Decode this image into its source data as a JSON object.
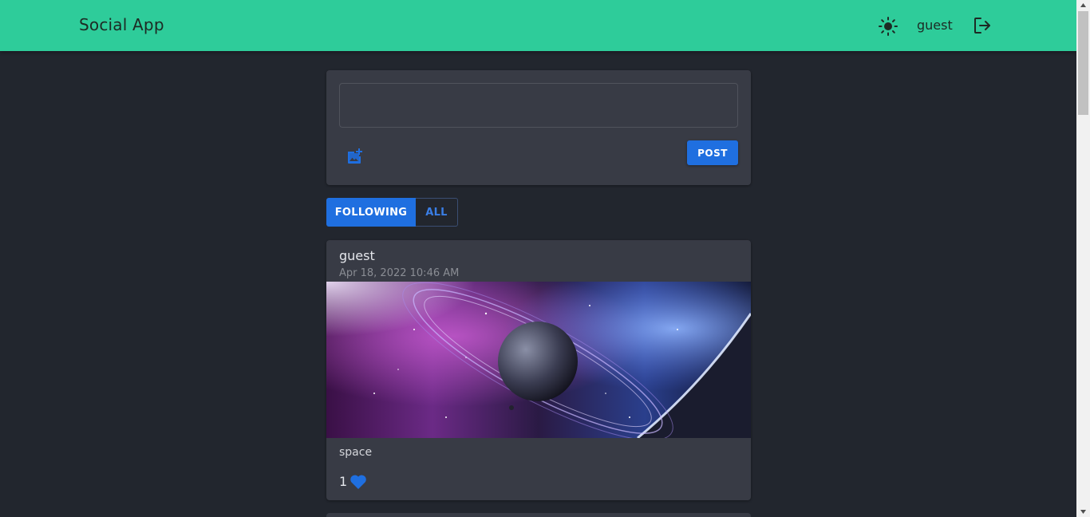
{
  "navbar": {
    "brand": "Social App",
    "theme_icon": "sun-icon",
    "username": "guest",
    "logout_icon": "logout-icon",
    "background": "#2ecc9a"
  },
  "composer": {
    "placeholder": "",
    "value": "",
    "add_photo_icon": "add-photo-icon",
    "post_label": "POST"
  },
  "feed_tabs": [
    {
      "label": "FOLLOWING",
      "selected": true
    },
    {
      "label": "ALL",
      "selected": false
    }
  ],
  "posts": [
    {
      "author": "guest",
      "timestamp": "Apr 18, 2022 10:46 AM",
      "image": "space-planet-image",
      "caption": "space",
      "likes": "1",
      "like_icon": "heart-icon"
    }
  ],
  "colors": {
    "accent": "#1f6fe0",
    "page_background": "#22262e",
    "card_background": "#383b45"
  }
}
